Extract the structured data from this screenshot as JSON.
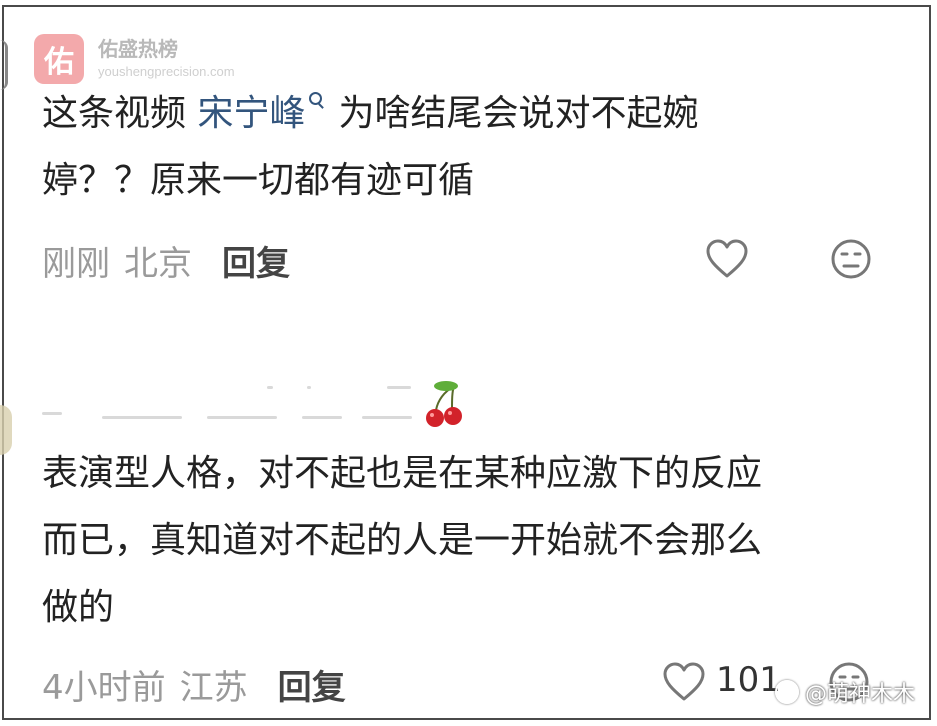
{
  "watermark_top": {
    "badge": "佑",
    "name": "佑盛热榜",
    "url": "youshengprecision.com"
  },
  "comment1": {
    "text_before": "这条视频 ",
    "mention": "宋宁峰",
    "text_after_line1": "为啥结尾会说对不起婉",
    "text_line2": "婷？？原来一切都有迹可循",
    "time": "刚刚",
    "location": "北京",
    "reply_label": "回复"
  },
  "comment2": {
    "line1": "表演型人格，对不起也是在某种应激下的反应",
    "line2": "而已，真知道对不起的人是一开始就不会那么",
    "line3": "做的",
    "time": "4小时前",
    "location": "江苏",
    "reply_label": "回复",
    "like_count": "101"
  },
  "footer_watermark": {
    "text": "@萌神木木"
  },
  "icons": {
    "like": "heart-icon",
    "dislike": "neutral-face-icon",
    "mention_search": "search-icon",
    "cherry": "cherry-icon"
  },
  "colors": {
    "mention": "#33557d",
    "meta": "#9a9a9a",
    "badge": "#f3a9ab"
  }
}
